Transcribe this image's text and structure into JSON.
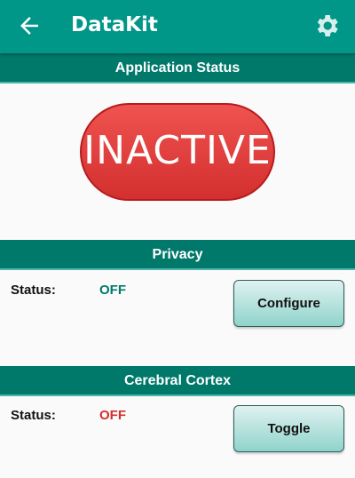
{
  "toolbar": {
    "title": "DataKit",
    "back_icon": "arrow-left-icon",
    "settings_icon": "gear-icon"
  },
  "app_status": {
    "header": "Application Status",
    "state": "INACTIVE",
    "color": "#e53935"
  },
  "privacy": {
    "header": "Privacy",
    "status_label": "Status:",
    "status_value": "OFF",
    "status_color": "#00796b",
    "button": "Configure"
  },
  "cortex": {
    "header": "Cerebral Cortex",
    "status_label": "Status:",
    "status_value": "OFF",
    "status_color": "#d32f2f",
    "button": "Toggle"
  }
}
